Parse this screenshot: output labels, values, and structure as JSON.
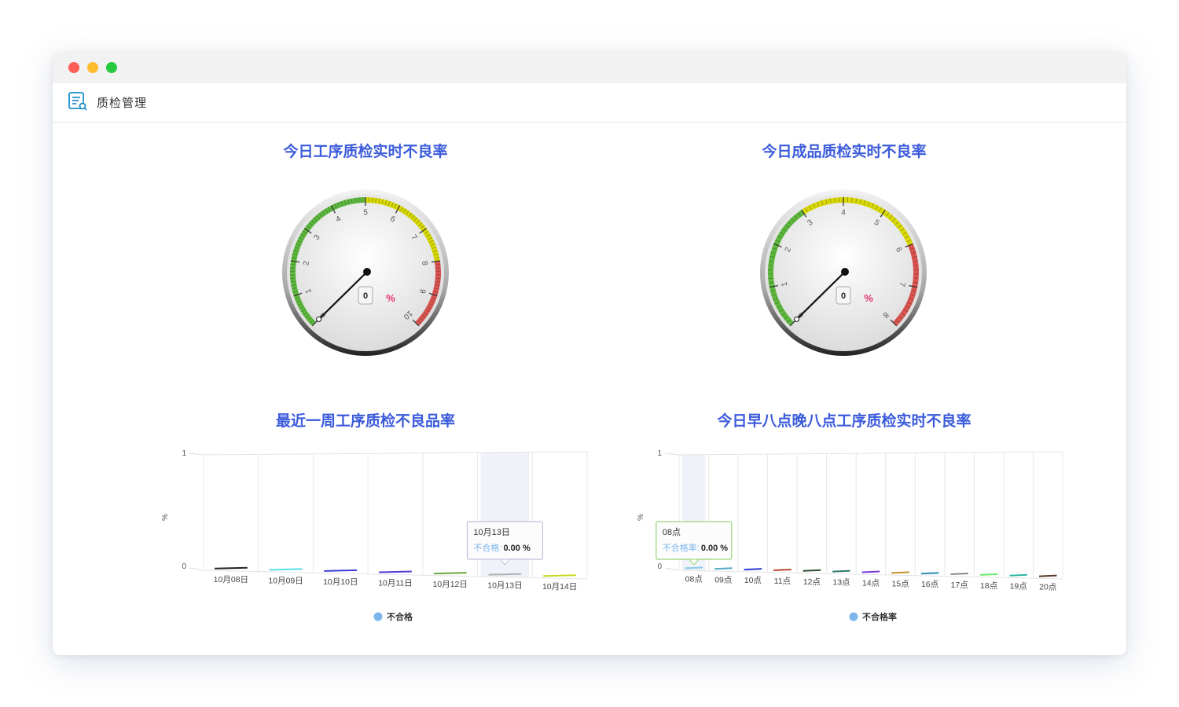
{
  "header": {
    "title": "质检管理",
    "icon": "search-document-icon"
  },
  "colors": {
    "accent": "#3b5bdb",
    "green": "#5cb83c",
    "yellow": "#d8d800",
    "red": "#d9534f",
    "unit": "#e8336b"
  },
  "chart_data": [
    {
      "type": "gauge",
      "title": "今日工序质检实时不良率",
      "min": 0,
      "max": 10,
      "ticks": [
        "0",
        "1",
        "2",
        "3",
        "4",
        "5",
        "6",
        "7",
        "8",
        "9",
        "10"
      ],
      "bands": [
        {
          "from": 0,
          "to": 5,
          "color": "#5cb83c"
        },
        {
          "from": 5,
          "to": 8,
          "color": "#d8d800"
        },
        {
          "from": 8,
          "to": 10,
          "color": "#d9534f"
        }
      ],
      "value": 0,
      "value_label": "0",
      "unit": "%"
    },
    {
      "type": "gauge",
      "title": "今日成品质检实时不良率",
      "min": 0,
      "max": 8,
      "ticks": [
        "0",
        "1",
        "2",
        "3",
        "4",
        "5",
        "6",
        "7",
        "8"
      ],
      "bands": [
        {
          "from": 0,
          "to": 3,
          "color": "#5cb83c"
        },
        {
          "from": 3,
          "to": 6,
          "color": "#d8d800"
        },
        {
          "from": 6,
          "to": 8,
          "color": "#d9534f"
        }
      ],
      "value": 0,
      "value_label": "0",
      "unit": "%"
    },
    {
      "type": "bar",
      "title": "最近一周工序质检不良品率",
      "ylabel": "%",
      "ylim": [
        0,
        1
      ],
      "yticks": [
        "0",
        "1"
      ],
      "categories": [
        "10月08日",
        "10月09日",
        "10月10日",
        "10月11日",
        "10月12日",
        "10月13日",
        "10月14日"
      ],
      "series": [
        {
          "name": "不合格",
          "values": [
            0,
            0,
            0,
            0,
            0,
            0,
            0
          ]
        }
      ],
      "bar_colors": [
        "#222222",
        "#55e0e8",
        "#3b3bd8",
        "#5a3bd8",
        "#6aa83c",
        "#b0b0b0",
        "#c8d820"
      ],
      "legend": {
        "label": "不合格",
        "color": "#7cb5ec"
      },
      "tooltip": {
        "category": "10月13日",
        "label": "不合格:",
        "value": "0.00 %"
      },
      "highlight_index": 5
    },
    {
      "type": "bar",
      "title": "今日早八点晚八点工序质检实时不良率",
      "ylabel": "%",
      "ylim": [
        0,
        1
      ],
      "yticks": [
        "0",
        "1"
      ],
      "categories": [
        "08点",
        "09点",
        "10点",
        "11点",
        "12点",
        "13点",
        "14点",
        "15点",
        "16点",
        "17点",
        "18点",
        "19点",
        "20点"
      ],
      "series": [
        {
          "name": "不合格率",
          "values": [
            0,
            0,
            0,
            0,
            0,
            0,
            0,
            0,
            0,
            0,
            0,
            0,
            0
          ]
        }
      ],
      "bar_colors": [
        "#88c8e8",
        "#5aa8c8",
        "#2b3bd8",
        "#b8452b",
        "#2a4a2a",
        "#2a7a6a",
        "#7a3bd8",
        "#c8902b",
        "#2b8ab8",
        "#8a8a8a",
        "#6ae86a",
        "#2bb8a0",
        "#5a3a2a"
      ],
      "legend": {
        "label": "不合格率",
        "color": "#7cb5ec"
      },
      "tooltip": {
        "category": "08点",
        "label": "不合格率:",
        "value": "0.00 %"
      },
      "highlight_index": 0
    }
  ]
}
